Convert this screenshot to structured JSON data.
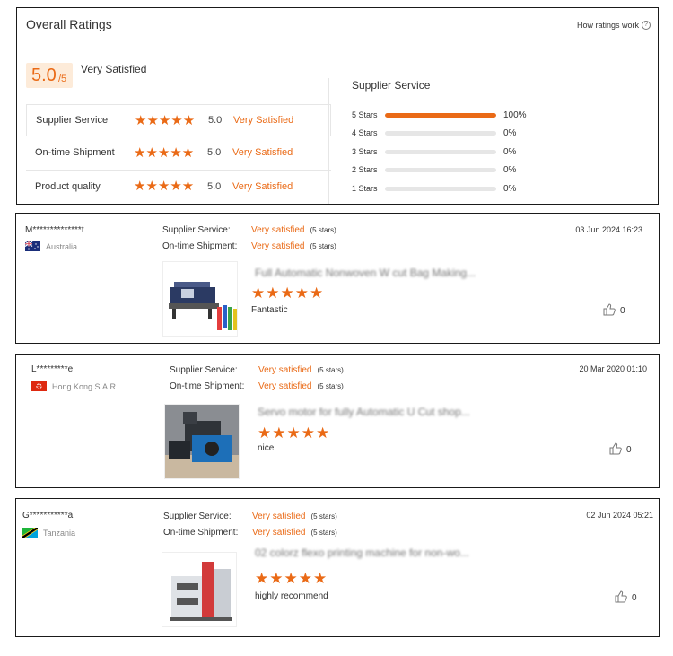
{
  "overall": {
    "title": "Overall Ratings",
    "how_link": "How ratings work",
    "score": "5.0",
    "score_out_of": "/5",
    "score_label": "Very Satisfied",
    "categories": [
      {
        "label": "Supplier Service",
        "stars": "★★★★★",
        "value": "5.0",
        "text": "Very Satisfied"
      },
      {
        "label": "On-time Shipment",
        "stars": "★★★★★",
        "value": "5.0",
        "text": "Very Satisfied"
      },
      {
        "label": "Product quality",
        "stars": "★★★★★",
        "value": "5.0",
        "text": "Very Satisfied"
      }
    ],
    "distribution_title": "Supplier Service",
    "distribution": [
      {
        "label": "5 Stars",
        "percent": "100%",
        "fraction": 1.0
      },
      {
        "label": "4 Stars",
        "percent": "0%",
        "fraction": 0
      },
      {
        "label": "3 Stars",
        "percent": "0%",
        "fraction": 0
      },
      {
        "label": "2 Stars",
        "percent": "0%",
        "fraction": 0
      },
      {
        "label": "1 Stars",
        "percent": "0%",
        "fraction": 0
      }
    ]
  },
  "reviews": [
    {
      "user": "M**************t",
      "country": "Australia",
      "supplier_label": "Supplier Service:",
      "supplier_value": "Very satisfied",
      "supplier_stars": "(5 stars)",
      "shipment_label": "On-time Shipment:",
      "shipment_value": "Very satisfied",
      "shipment_stars": "(5 stars)",
      "date": "03 Jun 2024 16:23",
      "product": "Full Automatic Nonwoven W cut Bag Making...",
      "stars": "★★★★★",
      "comment": "Fantastic",
      "likes": "0"
    },
    {
      "user": "L*********e",
      "country": "Hong Kong S.A.R.",
      "supplier_label": "Supplier Service:",
      "supplier_value": "Very satisfied",
      "supplier_stars": "(5 stars)",
      "shipment_label": "On-time Shipment:",
      "shipment_value": "Very satisfied",
      "shipment_stars": "(5 stars)",
      "date": "20 Mar 2020 01:10",
      "product": "Servo motor for fully Automatic U Cut shop...",
      "stars": "★★★★★",
      "comment": "nice",
      "likes": "0"
    },
    {
      "user": "G***********a",
      "country": "Tanzania",
      "supplier_label": "Supplier Service:",
      "supplier_value": "Very satisfied",
      "supplier_stars": "(5 stars)",
      "shipment_label": "On-time Shipment:",
      "shipment_value": "Very satisfied",
      "shipment_stars": "(5 stars)",
      "date": "02 Jun 2024 05:21",
      "product": "02 colorz flexo printing machine for non-wo...",
      "stars": "★★★★★",
      "comment": "highly recommend",
      "likes": "0"
    }
  ],
  "colors": {
    "accent": "#ea6a16",
    "accent_bg": "#fdebd9",
    "track": "#e6e6e6"
  }
}
